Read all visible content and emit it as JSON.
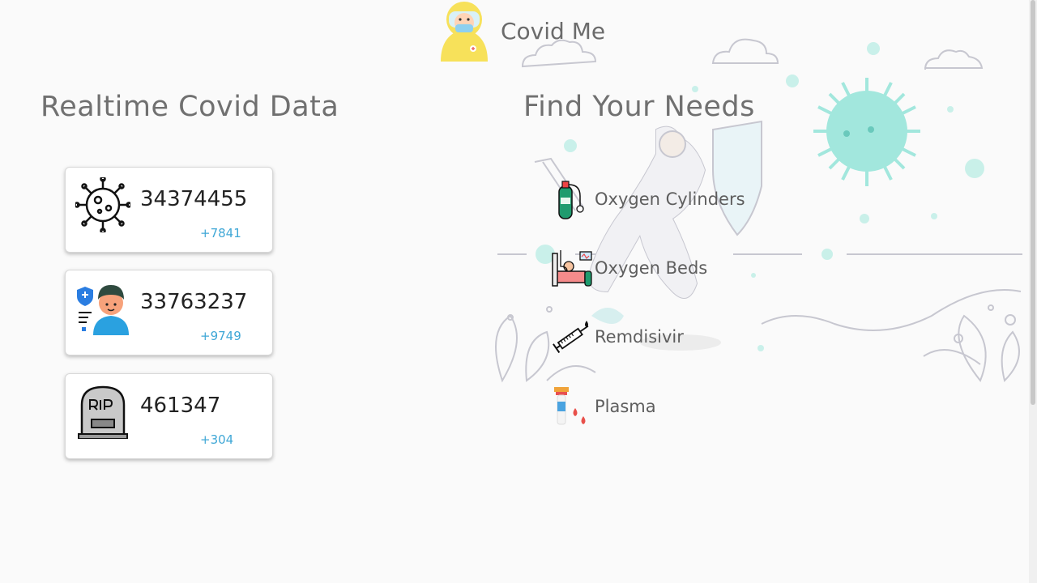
{
  "header": {
    "title": "Covid Me",
    "avatar_icon": "hazmat-doctor-icon"
  },
  "left": {
    "title": "Realtime Covid Data",
    "stats": [
      {
        "icon": "virus-icon",
        "value": "34374455",
        "delta": "+7841"
      },
      {
        "icon": "recovered-person-icon",
        "value": "33763237",
        "delta": "+9749"
      },
      {
        "icon": "tombstone-icon",
        "value": "461347",
        "delta": "+304"
      }
    ]
  },
  "right": {
    "title": "Find Your Needs",
    "items": [
      {
        "icon": "oxygen-cylinder-icon",
        "label": "Oxygen Cylinders"
      },
      {
        "icon": "hospital-bed-icon",
        "label": "Oxygen Beds"
      },
      {
        "icon": "syringe-icon",
        "label": "Remdisivir"
      },
      {
        "icon": "plasma-icon",
        "label": "Plasma"
      }
    ]
  },
  "colors": {
    "accent": "#3fa7d6",
    "title": "#707070",
    "virus": "#8de3d6"
  }
}
